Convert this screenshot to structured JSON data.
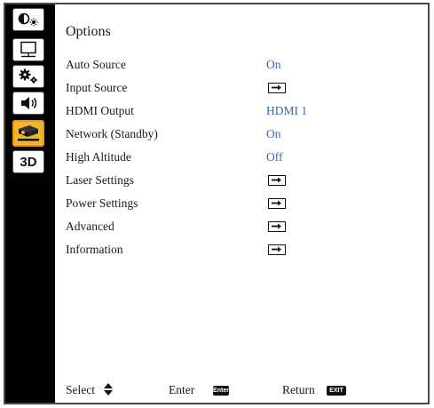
{
  "sidebar": {
    "items": [
      {
        "icon": "picture-icon",
        "active": false
      },
      {
        "icon": "screen-icon",
        "active": false
      },
      {
        "icon": "settings-icon",
        "active": false
      },
      {
        "icon": "volume-icon",
        "active": false
      },
      {
        "icon": "projector-options-icon",
        "active": true
      },
      {
        "icon": "3d-icon",
        "label": "3D",
        "active": false
      }
    ]
  },
  "panel": {
    "title": "Options",
    "rows": [
      {
        "label": "Auto Source",
        "value": "On"
      },
      {
        "label": "Input Source",
        "value": ""
      },
      {
        "label": "HDMI Output",
        "value": "HDMI 1"
      },
      {
        "label": "Network (Standby)",
        "value": "On"
      },
      {
        "label": "High Altitude",
        "value": "Off"
      },
      {
        "label": "Laser Settings",
        "value": ""
      },
      {
        "label": "Power Settings",
        "value": ""
      },
      {
        "label": "Advanced",
        "value": ""
      },
      {
        "label": "Information",
        "value": ""
      }
    ]
  },
  "footer": {
    "select_label": "Select",
    "enter_label": "Enter",
    "enter_key": "Enter",
    "return_label": "Return",
    "exit_key": "EXIT"
  },
  "colors": {
    "accent": "#f7b52c",
    "value_text": "#3b64b7",
    "background": "#ffffff",
    "sidebar_bg": "#000000"
  }
}
